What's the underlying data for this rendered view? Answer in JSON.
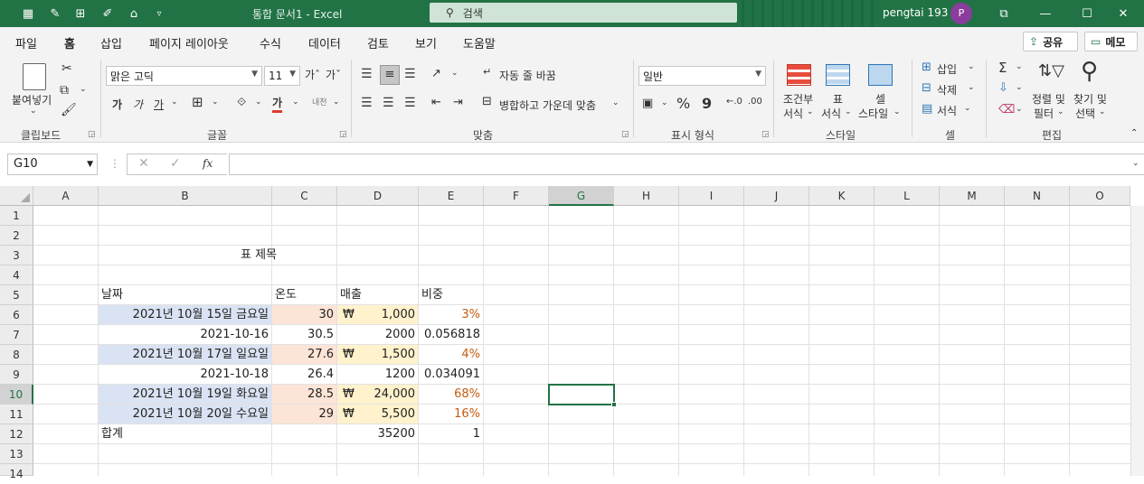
{
  "titlebar": {
    "doc_title": "통합 문서1  -  Excel",
    "search_placeholder": "검색",
    "user_name": "pengtai 193",
    "avatar_initial": "P",
    "accent": "#217346"
  },
  "menu": [
    "파일",
    "홈",
    "삽입",
    "페이지 레이아웃",
    "수식",
    "데이터",
    "검토",
    "보기",
    "도움말"
  ],
  "active_menu": "홈",
  "share_label": "공유",
  "memo_label": "메모",
  "ribbon": {
    "clipboard": {
      "paste": "붙여넣기",
      "group": "클립보드"
    },
    "font": {
      "name": "맑은 고딕",
      "size": "11",
      "bold": "가",
      "italic": "가",
      "underline": "가",
      "color_a": "가",
      "phonetic": "내천",
      "group": "글꼴"
    },
    "align": {
      "wrap": "자동 줄 바꿈",
      "merge": "병합하고 가운데 맞춤",
      "group": "맞춤"
    },
    "number": {
      "format": "일반",
      "percent": "%",
      "comma": "9",
      "group": "표시 형식"
    },
    "styles": {
      "cond_1": "조건부",
      "cond_2": "서식",
      "table_1": "표",
      "table_2": "서식",
      "cell_1": "셀",
      "cell_2": "스타일",
      "group": "스타일"
    },
    "cells": {
      "insert": "삽입",
      "delete": "삭제",
      "format": "서식",
      "group": "셀"
    },
    "edit": {
      "sort_1": "정렬 및",
      "sort_2": "필터",
      "find_1": "찾기 및",
      "find_2": "선택",
      "group": "편집"
    }
  },
  "formula_bar": {
    "name_box": "G10",
    "fx": "fx",
    "value": ""
  },
  "columns": [
    "A",
    "B",
    "C",
    "D",
    "E",
    "F",
    "G",
    "H",
    "I",
    "J",
    "K",
    "L",
    "M",
    "N",
    "O"
  ],
  "rows": [
    "1",
    "2",
    "3",
    "4",
    "5",
    "6",
    "7",
    "8",
    "9",
    "10",
    "11",
    "12",
    "13",
    "14"
  ],
  "sheet": {
    "title": "표 제목",
    "headers": {
      "date": "날짜",
      "temp": "온도",
      "sales": "매출",
      "ratio": "비중"
    },
    "data": [
      {
        "date": "2021년 10월 15일 금요일",
        "temp": "30",
        "won": "₩",
        "sales": "1,000",
        "ratio": "3%"
      },
      {
        "date": "2021-10-16",
        "temp": "30.5",
        "won": "",
        "sales": "2000",
        "ratio": "0.056818"
      },
      {
        "date": "2021년 10월 17일 일요일",
        "temp": "27.6",
        "won": "₩",
        "sales": "1,500",
        "ratio": "4%"
      },
      {
        "date": "2021-10-18",
        "temp": "26.4",
        "won": "",
        "sales": "1200",
        "ratio": "0.034091"
      },
      {
        "date": "2021년 10월 19일 화요일",
        "temp": "28.5",
        "won": "₩",
        "sales": "24,000",
        "ratio": "68%"
      },
      {
        "date": "2021년 10월 20일 수요일",
        "temp": "29",
        "won": "₩",
        "sales": "5,500",
        "ratio": "16%"
      }
    ],
    "total": {
      "label": "합계",
      "sales": "35200",
      "ratio": "1"
    }
  }
}
